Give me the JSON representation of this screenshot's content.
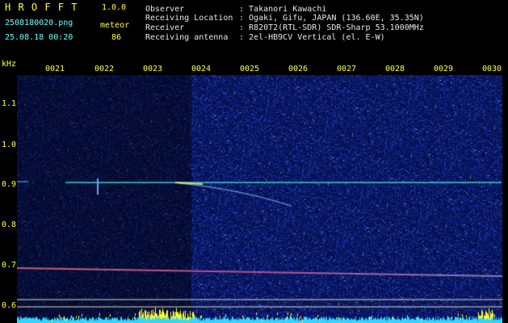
{
  "header": {
    "app_title": "H R O F F T",
    "version": "1.0.0",
    "filename": "2508180020.png",
    "mode_label": "meteor",
    "datetime": "25.08.18 00:20",
    "count": "86",
    "info": [
      {
        "label": "Observer",
        "value": ": Takanori Kawachi"
      },
      {
        "label": "Receiving Location",
        "value": ": Ogaki, Gifu, JAPAN (136.60E, 35.35N)"
      },
      {
        "label": "Receiver",
        "value": ": R820T2(RTL-SDR) SDR-Sharp 53.1000MHz"
      },
      {
        "label": "Receiving antenna",
        "value": ": 2el-HB9CV Vertical (el. E-W)"
      }
    ]
  },
  "axis": {
    "y_unit": "kHz",
    "y_ticks": [
      "1.1",
      "1.0",
      "0.9",
      "0.8",
      "0.7",
      "0.6"
    ],
    "x_ticks": [
      "0021",
      "0022",
      "0023",
      "0024",
      "0025",
      "0026",
      "0027",
      "0028",
      "0029",
      "0030"
    ]
  },
  "colors": {
    "background": "#000000",
    "label_yellow": "#ffff44",
    "label_cyan": "#66ffff",
    "noise_base": "#0a1a6e",
    "carrier_line": "#38d0c8",
    "lower_line": "#c8607a"
  }
}
